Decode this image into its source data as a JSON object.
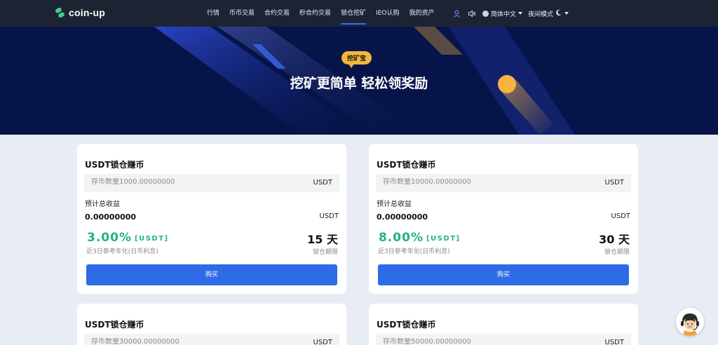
{
  "nav": {
    "logo_text": "coin-up",
    "items": [
      {
        "label": "行情"
      },
      {
        "label": "币币交易"
      },
      {
        "label": "合约交易"
      },
      {
        "label": "秒合约交易"
      },
      {
        "label": "锁仓挖矿",
        "active": true
      },
      {
        "label": "IEO认购"
      },
      {
        "label": "我的资产"
      }
    ],
    "language": "简体中文",
    "night_mode": "夜间模式",
    "icons": [
      "user-icon",
      "speaker-icon",
      "globe-icon",
      "moon-icon"
    ]
  },
  "banner": {
    "badge": "挖矿宝",
    "title": "挖矿更简单 轻松领奖励"
  },
  "cards": [
    {
      "title": "USDT锁仓赚币",
      "placeholder": "存币数量1000.00000000",
      "unit": "USDT",
      "income_label": "预计总收益",
      "income_value": "0.00000000",
      "income_unit": "USDT",
      "rate": "3.00%",
      "rate_tag": "[USDT]",
      "rate_note": "近3日参考年化(日币利息)",
      "days": "15 天",
      "days_label": "锁仓期限",
      "buy_label": "购买"
    },
    {
      "title": "USDT锁仓赚币",
      "placeholder": "存币数量10000.00000000",
      "unit": "USDT",
      "income_label": "预计总收益",
      "income_value": "0.00000000",
      "income_unit": "USDT",
      "rate": "8.00%",
      "rate_tag": "[USDT]",
      "rate_note": "近3日参考年化(日币利息)",
      "days": "30 天",
      "days_label": "锁仓期限",
      "buy_label": "购买"
    },
    {
      "title": "USDT锁仓赚币",
      "placeholder": "存币数量30000.00000000",
      "unit": "USDT"
    },
    {
      "title": "USDT锁仓赚币",
      "placeholder": "存币数量50000.00000000",
      "unit": "USDT"
    }
  ],
  "colors": {
    "nav_bg": "#1c2433",
    "banner_bg": "#071449",
    "accent_blue": "#2e6be6",
    "rate_green": "#21b18a",
    "badge_yellow": "#f4b73a"
  }
}
